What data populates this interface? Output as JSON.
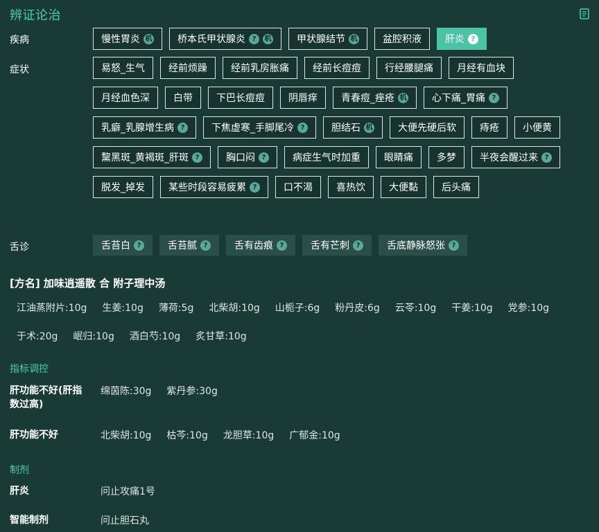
{
  "title": "辨证论治",
  "doc_icon": "document-icon",
  "disease": {
    "label": "疾病",
    "items": [
      {
        "text": "慢性胃炎",
        "badge": "机",
        "active": false
      },
      {
        "text": "桥本氏甲状腺炎",
        "badge": "?",
        "badge2": "机",
        "active": false
      },
      {
        "text": "甲状腺结节",
        "badge": "机",
        "active": false
      },
      {
        "text": "盆腔积液",
        "active": false
      },
      {
        "text": "肝炎",
        "badge": "?",
        "active": true
      }
    ]
  },
  "symptoms": {
    "label": "症状",
    "items": [
      {
        "text": "易怒_生气"
      },
      {
        "text": "经前烦躁"
      },
      {
        "text": "经前乳房胀痛"
      },
      {
        "text": "经前长痘痘"
      },
      {
        "text": "行经腰腿痛"
      },
      {
        "text": "月经有血块"
      },
      {
        "text": "月经血色深"
      },
      {
        "text": "白带"
      },
      {
        "text": "下巴长痘痘"
      },
      {
        "text": "阴唇痒"
      },
      {
        "text": "青春痘_痤疮",
        "badge": "机"
      },
      {
        "text": "心下痛_胃痛",
        "badge": "?"
      },
      {
        "text": "乳癖_乳腺增生病",
        "badge": "?"
      },
      {
        "text": "下焦虚寒_手脚尾冷",
        "badge": "?"
      },
      {
        "text": "胆结石",
        "badge": "机"
      },
      {
        "text": "大便先硬后软"
      },
      {
        "text": "痔疮"
      },
      {
        "text": "小便黄"
      },
      {
        "text": "黧黑斑_黄褐斑_肝斑",
        "badge": "?"
      },
      {
        "text": "胸口闷",
        "badge": "?"
      },
      {
        "text": "病症生气时加重"
      },
      {
        "text": "眼睛痛"
      },
      {
        "text": "多梦"
      },
      {
        "text": "半夜会醒过来",
        "badge": "?"
      },
      {
        "text": "脱发_掉发"
      },
      {
        "text": "某些时段容易疲累",
        "badge": "?"
      },
      {
        "text": "口不渴"
      },
      {
        "text": "喜热饮"
      },
      {
        "text": "大便黏"
      },
      {
        "text": "后头痛"
      }
    ]
  },
  "tongue": {
    "label": "舌诊",
    "items": [
      {
        "text": "舌苔白",
        "badge": "?"
      },
      {
        "text": "舌苔腻",
        "badge": "?"
      },
      {
        "text": "舌有齿痕",
        "badge": "?"
      },
      {
        "text": "舌有芒刺",
        "badge": "?"
      },
      {
        "text": "舌底静脉怒张",
        "badge": "?"
      }
    ]
  },
  "formula": {
    "title": "[方名] 加味逍遥散  合  附子理中汤",
    "herbs_row1": [
      "江油蒸附片:10g",
      "生姜:10g",
      "薄荷:5g",
      "北柴胡:10g",
      "山栀子:6g",
      "粉丹皮:6g",
      "云苓:10g",
      "干姜:10g",
      "党参:10g"
    ],
    "herbs_row2": [
      "于术:20g",
      "岷归:10g",
      "酒白芍:10g",
      "炙甘草:10g"
    ]
  },
  "indicator": {
    "head": "指标调控",
    "rows": [
      {
        "label": "肝功能不好(肝指数过高)",
        "values": [
          "绵茵陈:30g",
          "紫丹参:30g"
        ]
      },
      {
        "label": "肝功能不好",
        "values": [
          "北柴胡:10g",
          "枯芩:10g",
          "龙胆草:10g",
          "广郁金:10g"
        ]
      }
    ]
  },
  "preparation": {
    "head": "制剂",
    "rows": [
      {
        "label": "肝炎",
        "value": "问止攻痛1号"
      },
      {
        "label": "智能制剂",
        "value": "问止胆石丸"
      }
    ]
  }
}
